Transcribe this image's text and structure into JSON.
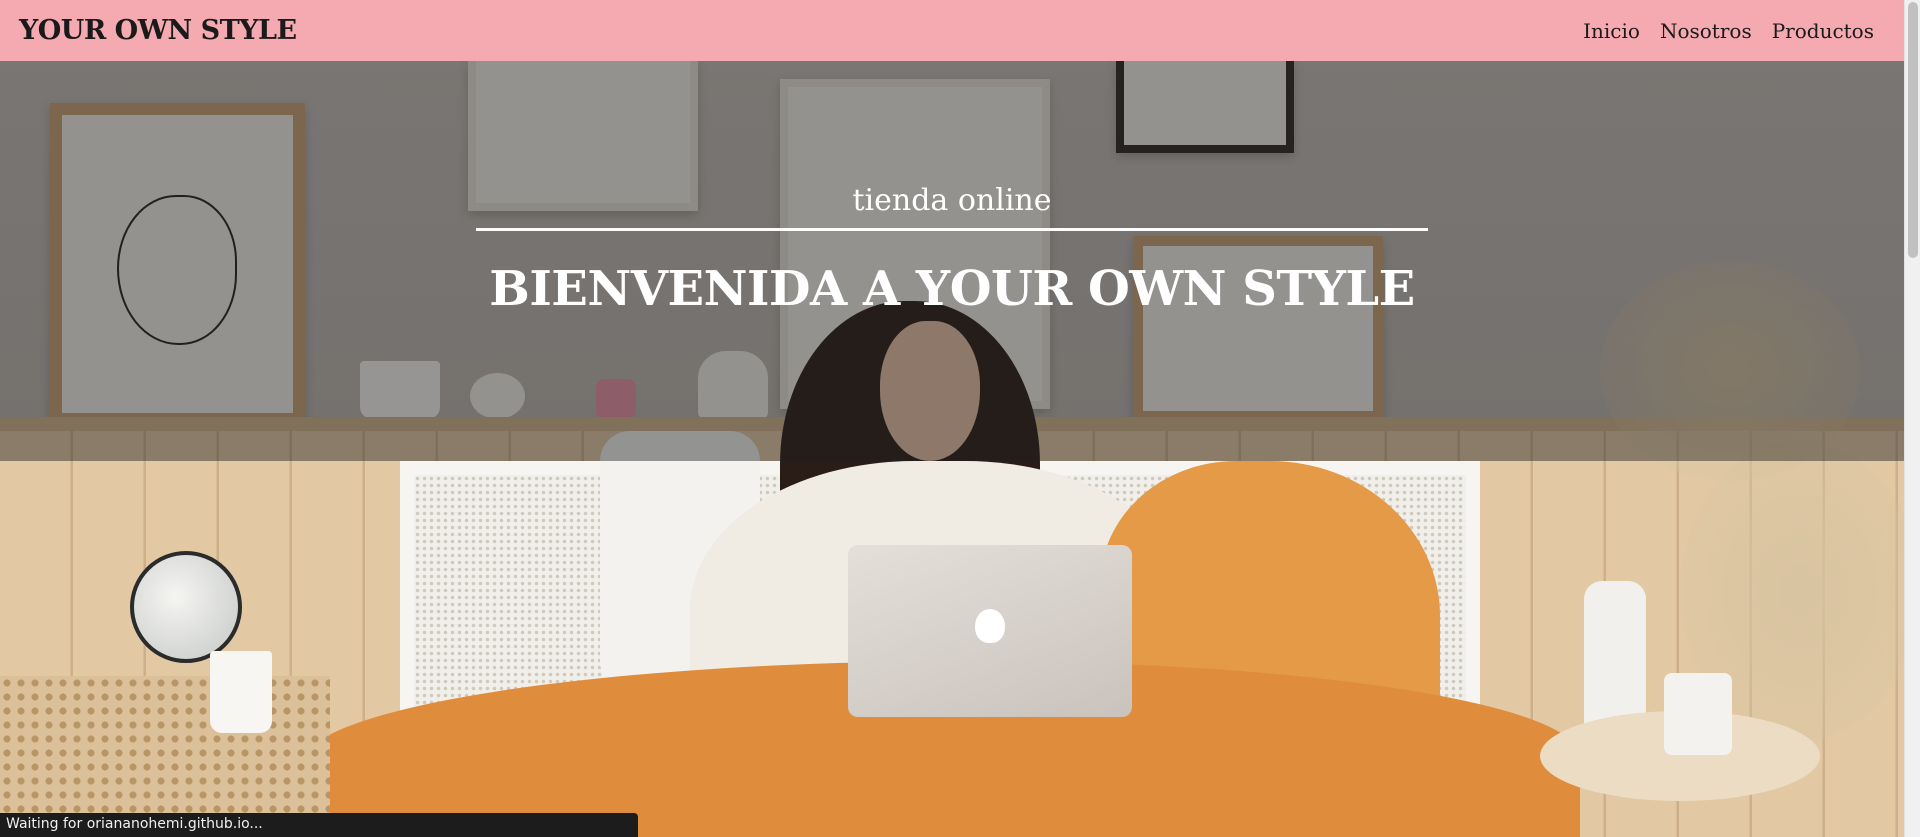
{
  "navbar": {
    "brand": "YOUR OWN STYLE",
    "links": [
      {
        "label": "Inicio"
      },
      {
        "label": "Nosotros"
      },
      {
        "label": "Productos"
      }
    ],
    "background_color": "#f4aab0"
  },
  "hero": {
    "subtitle": "tienda online",
    "title": "BIENVENIDA A YOUR OWN STYLE",
    "image_description_icon": "bedroom-photo"
  },
  "browser": {
    "status_text": "Waiting for oriananohemi.github.io..."
  }
}
